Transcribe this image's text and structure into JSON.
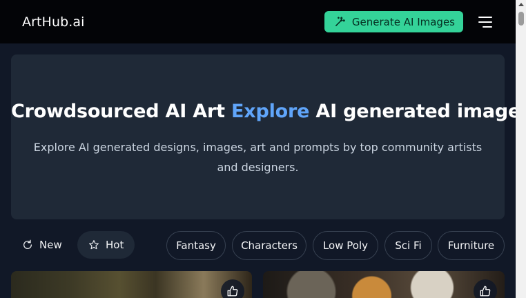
{
  "header": {
    "logo": "ArtHub.ai",
    "generate_button": "Generate AI Images",
    "generate_icon": "magic-wand-icon",
    "menu_icon": "hamburger-menu-icon"
  },
  "hero": {
    "title_part1": "Crowdsourced AI Art ",
    "title_accent": "Explore",
    "title_part2": " AI generated images",
    "subtitle": "Explore AI generated designs, images, art and prompts by top community artists and designers."
  },
  "tabs": [
    {
      "label": "New",
      "icon": "refresh-icon",
      "active": false
    },
    {
      "label": "Hot",
      "icon": "star-icon",
      "active": true
    }
  ],
  "categories": [
    {
      "label": "Fantasy"
    },
    {
      "label": "Characters"
    },
    {
      "label": "Low Poly"
    },
    {
      "label": "Sci Fi"
    },
    {
      "label": "Furniture"
    }
  ],
  "cards": [
    {
      "like_icon": "thumbs-up-icon"
    },
    {
      "like_icon": "thumbs-up-icon"
    }
  ],
  "colors": {
    "background": "#111827",
    "header": "#030407",
    "panel": "#1f2937",
    "accent_green": "#34d399",
    "accent_blue": "#60a5fa"
  }
}
